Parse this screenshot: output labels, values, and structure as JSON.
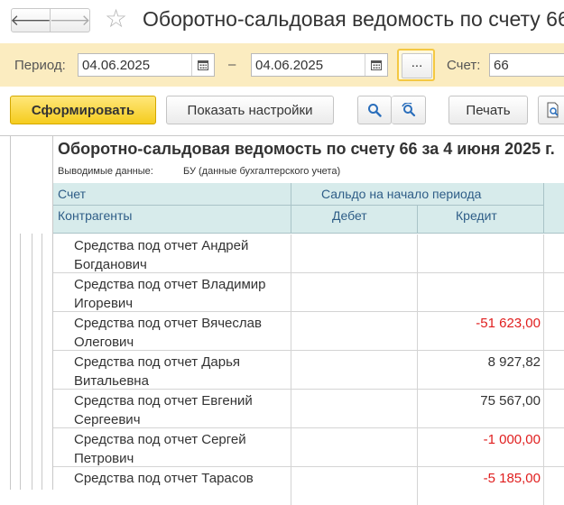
{
  "window": {
    "title": "Оборотно-сальдовая ведомость по счету 66",
    "back_icon": "arrow-left-icon",
    "forward_icon": "arrow-right-icon",
    "favorite_icon": "star-icon"
  },
  "period": {
    "label": "Период:",
    "date_from": "04.06.2025",
    "date_to": "04.06.2025",
    "separator": "–",
    "more_label": "...",
    "account_label": "Счет:",
    "account_value": "66"
  },
  "toolbar": {
    "generate_label": "Сформировать",
    "settings_label": "Показать настройки",
    "print_label": "Печать"
  },
  "report": {
    "title": "Оборотно-сальдовая ведомость по счету 66 за 4 июня 2025 г.",
    "output_label": "Выводимые данные:",
    "output_value": "БУ (данные бухгалтерского учета)",
    "header": {
      "account": "Счет",
      "counterparties": "Контрагенты",
      "opening_balance": "Сальдо на начало периода",
      "debit": "Дебет",
      "credit": "Кредит"
    },
    "rows": [
      {
        "name": "Средства под отчет Андрей Богданович",
        "debit": "",
        "credit": ""
      },
      {
        "name": "Средства под отчет Владимир Игоревич",
        "debit": "",
        "credit": ""
      },
      {
        "name": "Средства под отчет Вячеслав Олегович",
        "debit": "",
        "credit": "-51 623,00"
      },
      {
        "name": "Средства под отчет Дарья Витальевна",
        "debit": "",
        "credit": "8 927,82"
      },
      {
        "name": "Средства под отчет Евгений Сергеевич",
        "debit": "",
        "credit": "75 567,00"
      },
      {
        "name": "Средства под отчет Сергей Петрович",
        "debit": "",
        "credit": "-1 000,00"
      },
      {
        "name": "Средства под отчет Тарасов",
        "debit": "",
        "credit": "-5 185,00"
      }
    ]
  },
  "colors": {
    "accent_yellow": "#f5cc1e",
    "period_bar": "#fbecc0",
    "header_bg": "#d7ebeb",
    "negative": "#e01e1e"
  }
}
